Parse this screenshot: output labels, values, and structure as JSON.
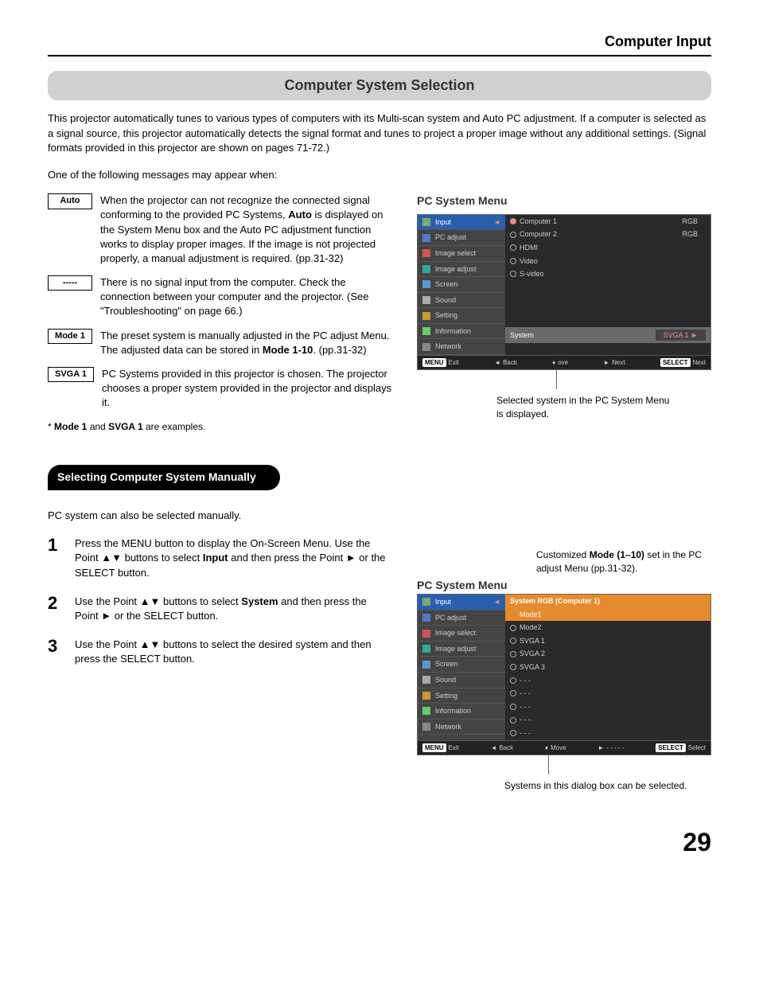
{
  "header": "Computer Input",
  "section_title": "Computer System Selection",
  "intro": "This projector automatically tunes to various types of computers with its Multi-scan system and Auto PC adjustment. If a computer is selected as a signal source, this projector automatically detects the signal format and tunes to project a proper image without any additional settings. (Signal formats provided in this projector are shown on pages 71-72.)",
  "sub_intro": "One of the following messages may appear when:",
  "messages": [
    {
      "label": "Auto",
      "text_parts": [
        "When the projector can not recognize the connected signal conforming to the provided PC Systems, ",
        "Auto",
        " is displayed on the System Menu box and the Auto PC adjustment function works to display proper images. If the image is not projected properly, a manual adjustment is required.   (pp.31-32)"
      ]
    },
    {
      "label": "-----",
      "text_parts": [
        "There is no signal input from the computer. Check the connection between your computer and the projector.  (See \"Troubleshooting\" on page 66.)"
      ]
    },
    {
      "label": "Mode 1",
      "text_parts": [
        "The preset system is manually adjusted in the PC adjust Menu. The adjusted data can be stored in ",
        "Mode 1-10",
        ".  (pp.31-32)"
      ]
    },
    {
      "label": "SVGA 1",
      "text_parts": [
        "PC Systems provided in this projector is chosen. The projector chooses a proper system provided in the projector and displays it."
      ]
    }
  ],
  "note_prefix": "* ",
  "note_bold1": "Mode 1",
  "note_mid": " and ",
  "note_bold2": "SVGA 1",
  "note_suffix": " are examples.",
  "manual_heading": "Selecting Computer System Manually",
  "manual_intro": "PC system can also be selected manually.",
  "steps": [
    {
      "num": "1",
      "parts": [
        "Press the MENU button to display the On-Screen Menu. Use the Point ▲▼ buttons to select ",
        "Input",
        " and then press the Point ► or the SELECT button."
      ]
    },
    {
      "num": "2",
      "parts": [
        "Use the Point ▲▼ buttons to select ",
        "System",
        " and then press the Point ► or the SELECT button."
      ]
    },
    {
      "num": "3",
      "parts": [
        "Use the Point ▲▼ buttons to select the desired system and then press the SELECT button."
      ]
    }
  ],
  "menu1": {
    "title": "PC System Menu",
    "sidebar": [
      "Input",
      "PC adjust",
      "Image select",
      "Image adjust",
      "Screen",
      "Sound",
      "Setting",
      "Information",
      "Network"
    ],
    "subs": [
      {
        "label": "Computer 1",
        "right": "RGB",
        "sel": true
      },
      {
        "label": "Computer 2",
        "right": "RGB"
      },
      {
        "label": "HDMI"
      },
      {
        "label": "Video"
      },
      {
        "label": "S-video"
      }
    ],
    "system_label": "System",
    "system_value": "SVGA 1 ►",
    "footer": {
      "exit": "Exit",
      "back": "Back",
      "move": "ove",
      "next": "Next",
      "select_label": "Next"
    },
    "caption": "Selected system in the PC System Menu is displayed."
  },
  "menu2": {
    "title": "PC System Menu",
    "top_annotation": "Customized Mode (1–10) set in the PC adjust Menu (pp.31-32).",
    "sidebar": [
      "Input",
      "PC adjust",
      "Image select",
      "Image adjust",
      "Screen",
      "Sound",
      "Setting",
      "Information",
      "Network"
    ],
    "head": "System RGB (Computer 1)",
    "subs": [
      {
        "label": "Mode1",
        "sel": true
      },
      {
        "label": "Mode2"
      },
      {
        "label": "SVGA 1"
      },
      {
        "label": "SVGA 2"
      },
      {
        "label": "SVGA 3"
      },
      {
        "label": "- - -"
      },
      {
        "label": "- - -"
      },
      {
        "label": "- - -"
      },
      {
        "label": "- - -"
      },
      {
        "label": "- - -"
      }
    ],
    "footer": {
      "exit": "Exit",
      "back": "Back",
      "move": "Move",
      "next": "- - - - -",
      "select_label": "Select"
    },
    "caption": "Systems in this dialog box can be selected."
  },
  "page_number": "29",
  "foot_btn": {
    "menu": "MENU",
    "select": "SELECT"
  }
}
